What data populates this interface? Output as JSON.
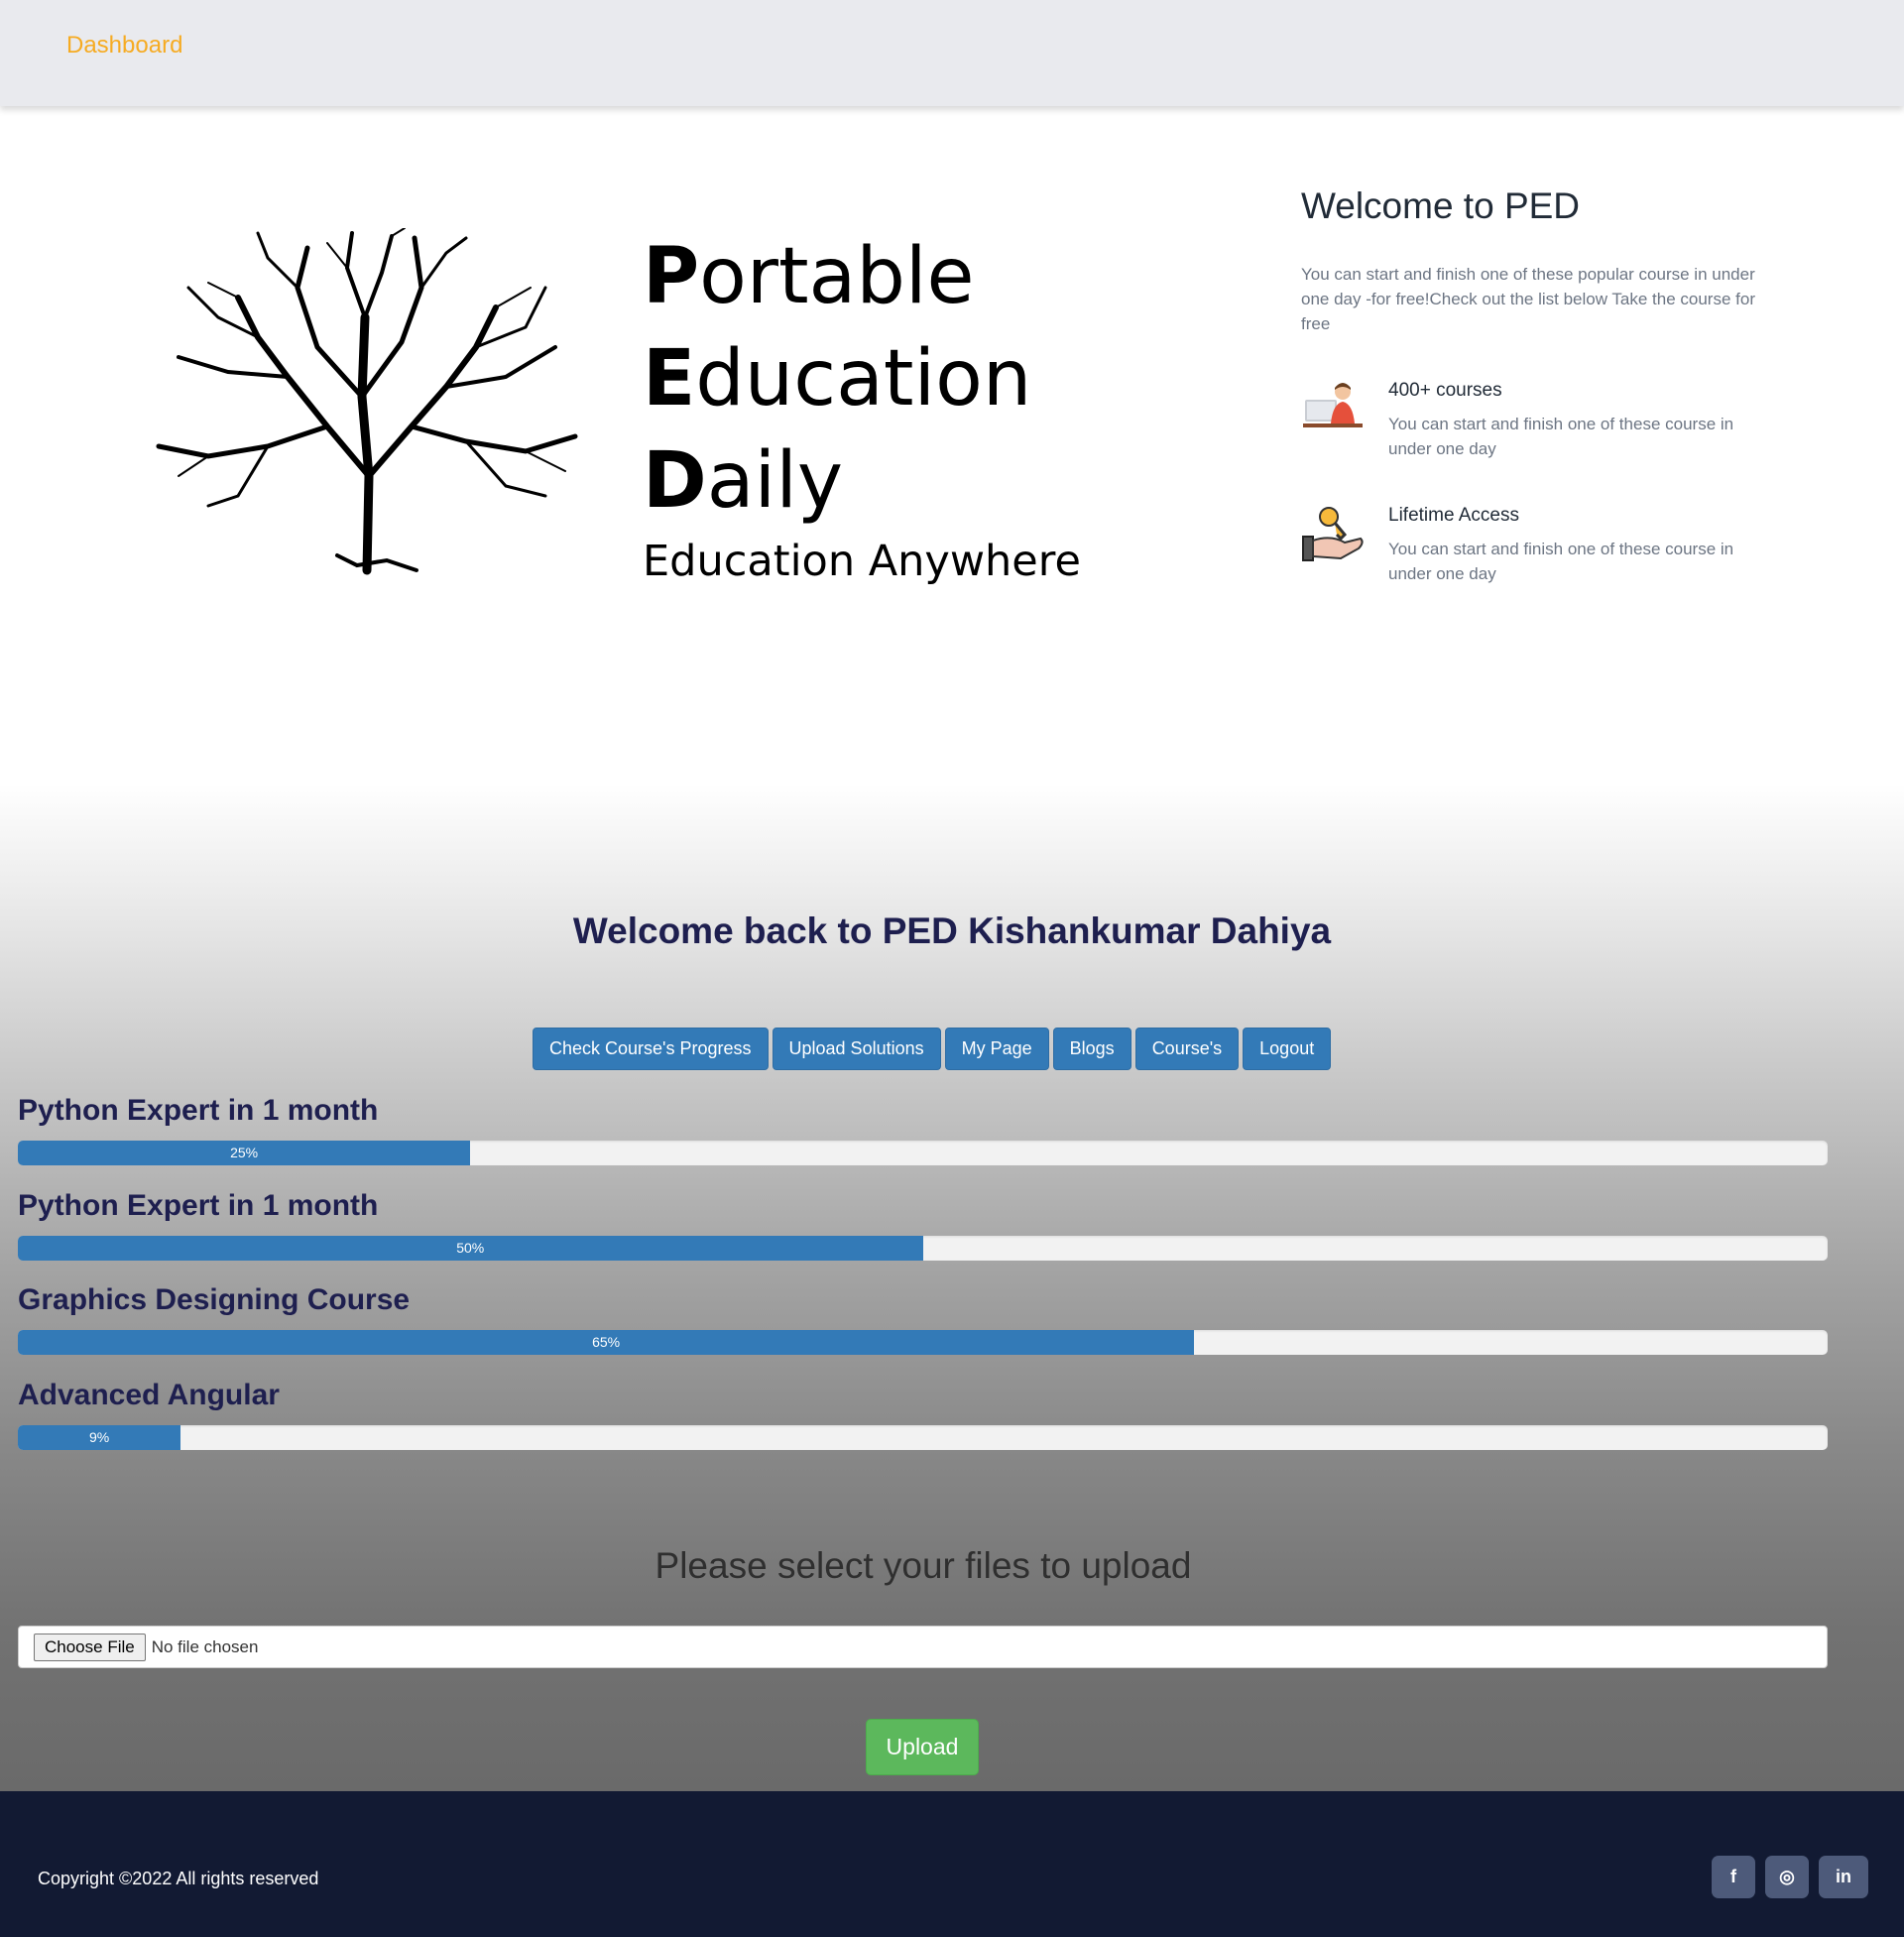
{
  "navbar": {
    "brand": "Dashboard"
  },
  "hero": {
    "logo_lines": [
      {
        "initial": "P",
        "rest": "ortable"
      },
      {
        "initial": "E",
        "rest": "ducation"
      },
      {
        "initial": "D",
        "rest": "aily"
      }
    ],
    "tagline": "Education Anywhere",
    "welcome_title": "Welcome to PED",
    "welcome_desc": "You can start and finish one of these popular course in under one day -for free!Check out the list below Take the course for free",
    "features": [
      {
        "icon": "teacher-at-computer-icon",
        "title": "400+ courses",
        "desc": "You can start and finish one of these course in under one day"
      },
      {
        "icon": "key-in-hand-icon",
        "title": "Lifetime Access",
        "desc": "You can start and finish one of these course in under one day"
      }
    ]
  },
  "dashboard": {
    "welcome_back": "Welcome back to PED Kishankumar Dahiya",
    "buttons": [
      "Check Course's Progress",
      "Upload Solutions",
      "My Page",
      "Blogs",
      "Course's",
      "Logout"
    ],
    "courses": [
      {
        "title": "Python Expert in 1 month",
        "progress": 25,
        "label": "25%"
      },
      {
        "title": "Python Expert in 1 month",
        "progress": 50,
        "label": "50%"
      },
      {
        "title": "Graphics Designing Course",
        "progress": 65,
        "label": "65%"
      },
      {
        "title": "Advanced Angular",
        "progress": 9,
        "label": "9%"
      }
    ],
    "progress_color": "#337ab7"
  },
  "upload": {
    "title": "Please select your files to upload",
    "choose_label": "Choose File",
    "file_status": "No file chosen",
    "submit_label": "Upload",
    "submit_color": "#5cb85c"
  },
  "footer": {
    "copyright": "Copyright ©2022 All rights reserved",
    "social": [
      {
        "icon": "facebook-icon",
        "glyph": "f"
      },
      {
        "icon": "instagram-icon",
        "glyph": "◎"
      },
      {
        "icon": "linkedin-icon",
        "glyph": "in"
      }
    ]
  },
  "colors": {
    "brand": "#f6ab22",
    "heading": "#1e1f4f",
    "footer_bg": "#121a33"
  }
}
